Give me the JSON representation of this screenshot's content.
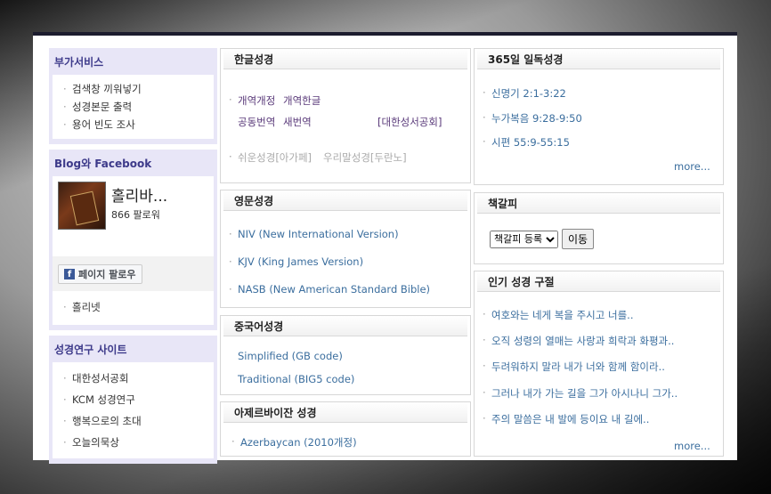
{
  "sidebar": {
    "services": {
      "title": "부가서비스",
      "items": [
        "검색창 끼워넣기",
        "성경본문 출력",
        "용어 빈도 조사"
      ]
    },
    "blog": {
      "title": "Blog와 Facebook",
      "profile_name": "홀리바...",
      "followers": "866 팔로워",
      "follow_button": "페이지 팔로우",
      "fb_glyph": "f",
      "items": [
        "홀리넷"
      ]
    },
    "research": {
      "title": "성경연구 사이트",
      "items": [
        "대한성서공회",
        "KCM 성경연구",
        "행복으로의 초대",
        "오늘의묵상"
      ]
    }
  },
  "korean": {
    "title": "한글성경",
    "row1": [
      "개역개정",
      "개역한글"
    ],
    "row2": [
      "공동번역",
      "새번역"
    ],
    "publisher": "[대한성서공회]",
    "row3": [
      "쉬운성경[아가페]",
      "우리말성경[두란노]"
    ]
  },
  "english": {
    "title": "영문성경",
    "items": [
      "NIV (New International Version)",
      "KJV (King James Version)",
      "NASB (New American Standard Bible)"
    ]
  },
  "chinese": {
    "title": "중국어성경",
    "items": [
      "Simplified (GB code)",
      "Traditional (BIG5 code)"
    ]
  },
  "azerbaijani": {
    "title": "아제르바이잔 성경",
    "items": [
      "Azerbaycan (2010개정)"
    ]
  },
  "daily": {
    "title": "365일 일독성경",
    "items": [
      "신명기 2:1-3:22",
      "누가복음 9:28-9:50",
      "시편 55:9-55:15"
    ],
    "more": "more..."
  },
  "bookmark": {
    "title": "책갈피",
    "select_value": "책갈피 등록",
    "go_button": "이동"
  },
  "popular": {
    "title": "인기 성경 구절",
    "items": [
      "여호와는 네게 복을 주시고 너를..",
      "오직 성령의 열매는 사랑과 희락과 화평과..",
      "두려워하지 말라 내가 너와 함께 함이라..",
      "그러나 내가 가는 길을 그가 아시나니 그가..",
      "주의 말씀은 내 발에 등이요 내 길에.."
    ],
    "more": "more..."
  }
}
